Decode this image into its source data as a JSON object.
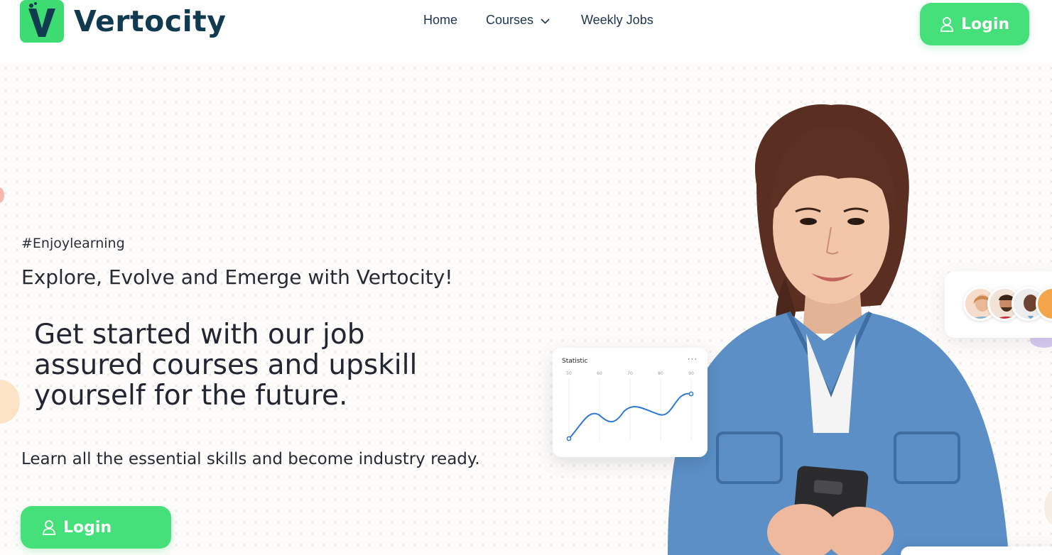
{
  "brand": {
    "name": "Vertocity",
    "accent": "#3ddc72",
    "text_color": "#0f3a4f"
  },
  "nav": {
    "items": [
      {
        "label": "Home"
      },
      {
        "label": "Courses"
      },
      {
        "label": "Weekly Jobs"
      }
    ]
  },
  "header": {
    "login_label": "Login",
    "login_icon": "user-icon"
  },
  "hero": {
    "tag": "#Enjoylearning",
    "subheading": "Explore, Evolve and Emerge with Vertocity!",
    "headline": "Get started with our job assured courses and upskill yourself for the future.",
    "lead": "Learn all the essential skills and become industry ready.",
    "login_label": "Login",
    "login_icon": "user-icon"
  },
  "stat_card": {
    "title": "Statistic",
    "more": "···",
    "columns": [
      "50",
      "60",
      "70",
      "80",
      "90"
    ]
  }
}
